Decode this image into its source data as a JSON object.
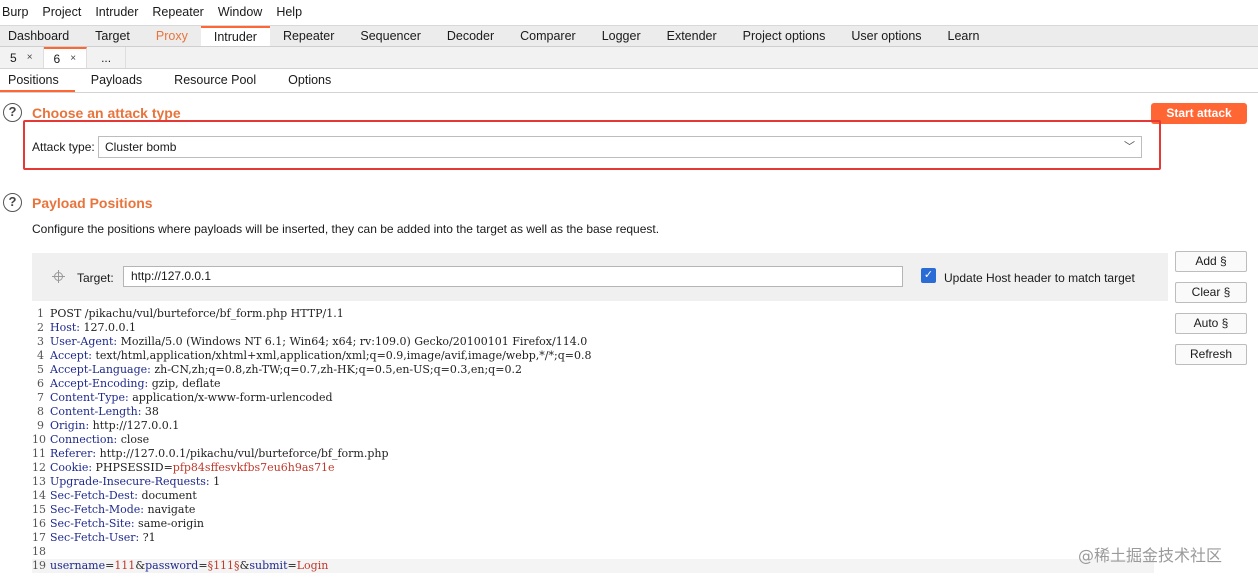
{
  "menu": [
    "Burp",
    "Project",
    "Intruder",
    "Repeater",
    "Window",
    "Help"
  ],
  "tabs": [
    "Dashboard",
    "Target",
    "Proxy",
    "Intruder",
    "Repeater",
    "Sequencer",
    "Decoder",
    "Comparer",
    "Logger",
    "Extender",
    "Project options",
    "User options",
    "Learn"
  ],
  "attack_tabs": [
    {
      "label": "5",
      "close": "×"
    },
    {
      "label": "6",
      "close": "×"
    },
    {
      "label": "..."
    }
  ],
  "inner_tabs": [
    "Positions",
    "Payloads",
    "Resource Pool",
    "Options"
  ],
  "attack_type": {
    "title": "Choose an attack type",
    "label": "Attack type:",
    "value": "Cluster bomb",
    "start_label": "Start attack"
  },
  "payload_positions": {
    "title": "Payload Positions",
    "description": "Configure the positions where payloads will be inserted, they can be added into the target as well as the base request.",
    "target_label": "Target:",
    "target_value": "http://127.0.0.1",
    "update_host_label": "Update Host header to match target",
    "update_host_checked": true,
    "buttons": [
      "Add §",
      "Clear §",
      "Auto §",
      "Refresh"
    ]
  },
  "request_lines": [
    {
      "n": "1",
      "text": "POST /pikachu/vul/burteforce/bf_form.php HTTP/1.1"
    },
    {
      "n": "2",
      "key": "Host:",
      "val": " 127.0.0.1"
    },
    {
      "n": "3",
      "key": "User-Agent:",
      "val": " Mozilla/5.0 (Windows NT 6.1; Win64; x64; rv:109.0) Gecko/20100101 Firefox/114.0"
    },
    {
      "n": "4",
      "key": "Accept:",
      "val": " text/html,application/xhtml+xml,application/xml;q=0.9,image/avif,image/webp,*/*;q=0.8"
    },
    {
      "n": "5",
      "key": "Accept-Language:",
      "val": " zh-CN,zh;q=0.8,zh-TW;q=0.7,zh-HK;q=0.5,en-US;q=0.3,en;q=0.2"
    },
    {
      "n": "6",
      "key": "Accept-Encoding:",
      "val": " gzip, deflate"
    },
    {
      "n": "7",
      "key": "Content-Type:",
      "val": " application/x-www-form-urlencoded"
    },
    {
      "n": "8",
      "key": "Content-Length:",
      "val": " 38"
    },
    {
      "n": "9",
      "key": "Origin:",
      "val": " http://127.0.0.1"
    },
    {
      "n": "10",
      "key": "Connection:",
      "val": " close"
    },
    {
      "n": "11",
      "key": "Referer:",
      "val": " http://127.0.0.1/pikachu/vul/burteforce/bf_form.php"
    },
    {
      "n": "12",
      "key": "Cookie:",
      "val": " PHPSESSID=",
      "red": "pfp84sffesvkfbs7eu6h9as71e"
    },
    {
      "n": "13",
      "key": "Upgrade-Insecure-Requests:",
      "val": " 1"
    },
    {
      "n": "14",
      "key": "Sec-Fetch-Dest:",
      "val": " document"
    },
    {
      "n": "15",
      "key": "Sec-Fetch-Mode:",
      "val": " navigate"
    },
    {
      "n": "16",
      "key": "Sec-Fetch-Site:",
      "val": " same-origin"
    },
    {
      "n": "17",
      "key": "Sec-Fetch-User:",
      "val": " ?1"
    },
    {
      "n": "18",
      "text": ""
    },
    {
      "n": "19",
      "body": [
        {
          "k": "username"
        },
        {
          "t": "="
        },
        {
          "r": "111"
        },
        {
          "t": "&"
        },
        {
          "k": "password"
        },
        {
          "t": "="
        },
        {
          "r": "§111§"
        },
        {
          "t": "&"
        },
        {
          "k": "submit"
        },
        {
          "t": "="
        },
        {
          "r": "Login"
        }
      ]
    }
  ],
  "watermark": "@稀土掘金技术社区",
  "colors": {
    "accent": "#ff6633",
    "title": "#e8743b",
    "highlight_box": "#e53935"
  }
}
